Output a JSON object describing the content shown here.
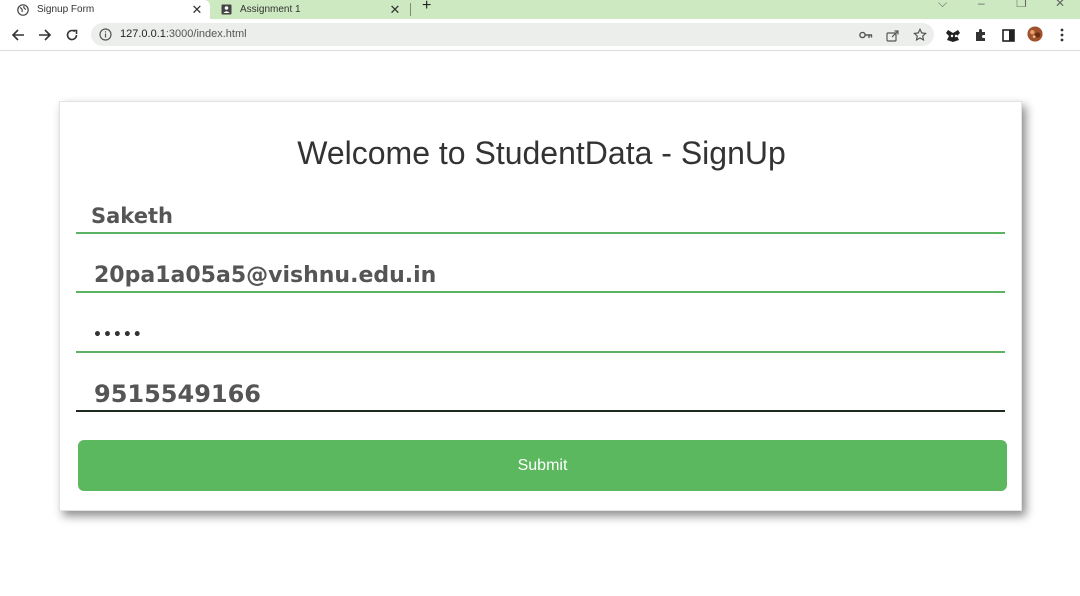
{
  "browser": {
    "tabs": [
      {
        "title": "Signup Form",
        "active": true
      },
      {
        "title": "Assignment 1",
        "active": false
      }
    ],
    "url_host": "127.0.0.1",
    "url_rest": ":3000/index.html"
  },
  "page": {
    "heading": "Welcome to StudentData - SignUp",
    "form": {
      "name_value": "Saketh",
      "email_value": "20pa1a05a5@vishnu.edu.in",
      "password_value": "•••••",
      "phone_value": "9515549166",
      "submit_label": "Submit"
    }
  },
  "colors": {
    "tabstrip": "#cde9c1",
    "accent_green": "#5cb85f",
    "heading_text": "#333333"
  }
}
